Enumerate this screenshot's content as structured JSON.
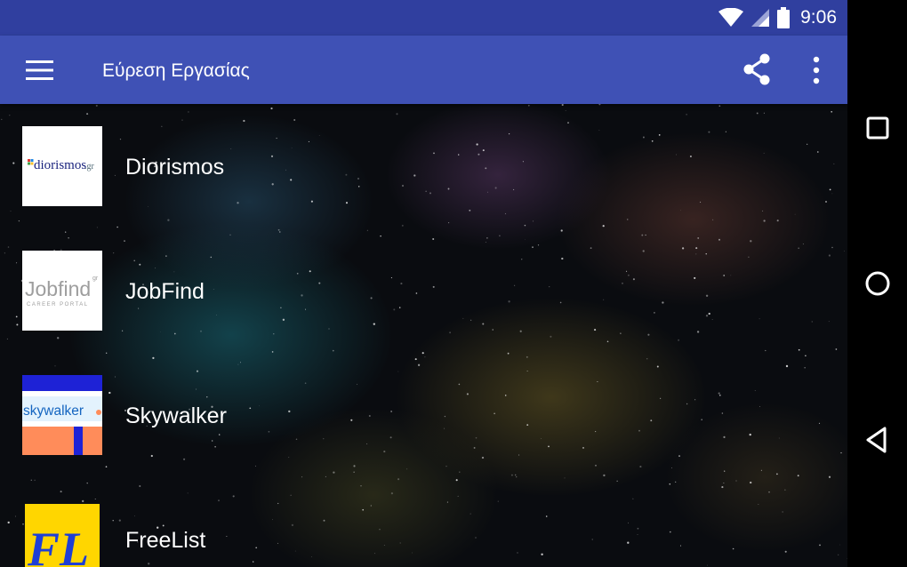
{
  "status_bar": {
    "time": "9:06"
  },
  "app_bar": {
    "title": "Εύρεση Εργασίας"
  },
  "list": [
    {
      "label": "Diorismos",
      "logo_text": "diorismos",
      "logo_suffix": ".gr",
      "icon": "diorismos-logo"
    },
    {
      "label": "JobFind",
      "logo_text": "Jobfind",
      "logo_suffix": "gr",
      "logo_sub": "CAREER PORTAL",
      "icon": "jobfind-logo"
    },
    {
      "label": "Skywalker",
      "logo_text": "skywalker",
      "icon": "skywalker-logo"
    },
    {
      "label": "FreeList",
      "logo_text": "FL",
      "icon": "freelist-logo"
    }
  ],
  "colors": {
    "status_bar": "#303f9f",
    "app_bar": "#3f51b5",
    "text": "#ffffff"
  },
  "nav": [
    "recents-icon",
    "home-icon",
    "back-icon"
  ]
}
